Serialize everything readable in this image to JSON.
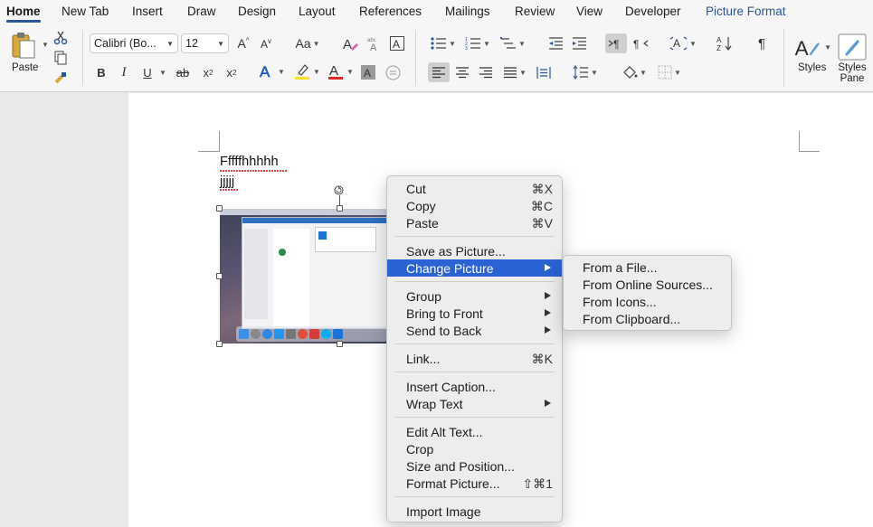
{
  "tabs": [
    {
      "label": "Home"
    },
    {
      "label": "New Tab"
    },
    {
      "label": "Insert"
    },
    {
      "label": "Draw"
    },
    {
      "label": "Design"
    },
    {
      "label": "Layout"
    },
    {
      "label": "References"
    },
    {
      "label": "Mailings"
    },
    {
      "label": "Review"
    },
    {
      "label": "View"
    },
    {
      "label": "Developer"
    },
    {
      "label": "Picture Format"
    }
  ],
  "ribbon": {
    "paste_label": "Paste",
    "font_name": "Calibri (Bo...",
    "font_size": "12",
    "change_case": "Aa",
    "bold": "B",
    "italic": "I",
    "underline": "U",
    "strike": "ab",
    "subscript": "x",
    "superscript": "x",
    "sub_mark": "2",
    "sup_mark": "2",
    "styles_label": "Styles",
    "styles_pane_label": "Styles Pane",
    "accent_color": "#2b579a",
    "highlight_color": "#f5e425",
    "font_color": "#e02a2a"
  },
  "document": {
    "line1": "Fffffhhhhh",
    "line2": "jjjjj"
  },
  "context_menu": {
    "items": [
      {
        "label": "Cut",
        "shortcut": "⌘X"
      },
      {
        "label": "Copy",
        "shortcut": "⌘C"
      },
      {
        "label": "Paste",
        "shortcut": "⌘V"
      },
      {
        "label": "Save as Picture...",
        "shortcut": ""
      },
      {
        "label": "Change Picture",
        "shortcut": ""
      },
      {
        "label": "Group",
        "shortcut": ""
      },
      {
        "label": "Bring to Front",
        "shortcut": ""
      },
      {
        "label": "Send to Back",
        "shortcut": ""
      },
      {
        "label": "Link...",
        "shortcut": "⌘K"
      },
      {
        "label": "Insert Caption...",
        "shortcut": ""
      },
      {
        "label": "Wrap Text",
        "shortcut": ""
      },
      {
        "label": "Edit Alt Text...",
        "shortcut": ""
      },
      {
        "label": "Crop",
        "shortcut": ""
      },
      {
        "label": "Size and Position...",
        "shortcut": ""
      },
      {
        "label": "Format Picture...",
        "shortcut": "⇧⌘1"
      },
      {
        "label": "Import Image",
        "shortcut": ""
      }
    ]
  },
  "submenu": {
    "items": [
      {
        "label": "From a File..."
      },
      {
        "label": "From Online Sources..."
      },
      {
        "label": "From Icons..."
      },
      {
        "label": "From Clipboard..."
      }
    ]
  }
}
